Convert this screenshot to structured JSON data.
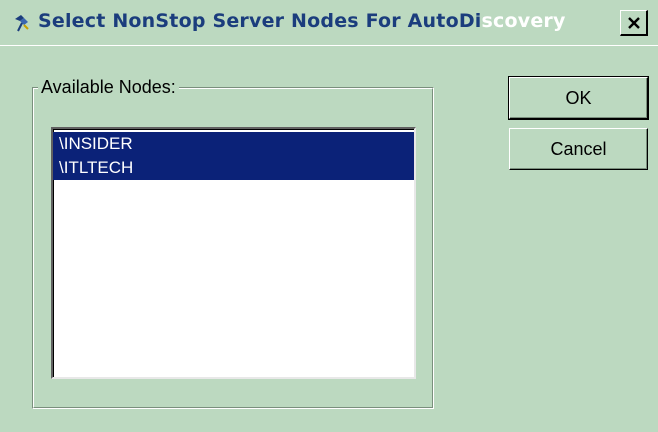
{
  "window": {
    "title_main": "Select NonStop Server Nodes For AutoDi",
    "title_fade": "scovery",
    "close_label": "X",
    "icon": "app-pin-icon"
  },
  "nodes_group": {
    "label": "Available Nodes:",
    "items": [
      {
        "label": "\\INSIDER",
        "selected": true
      },
      {
        "label": "\\ITLTECH",
        "selected": true
      }
    ]
  },
  "buttons": {
    "ok_label": "OK",
    "cancel_label": "Cancel"
  },
  "colors": {
    "dialog_bg": "#bcd9c0",
    "selection_bg": "#0b2278",
    "title_text": "#1b3d7d"
  }
}
